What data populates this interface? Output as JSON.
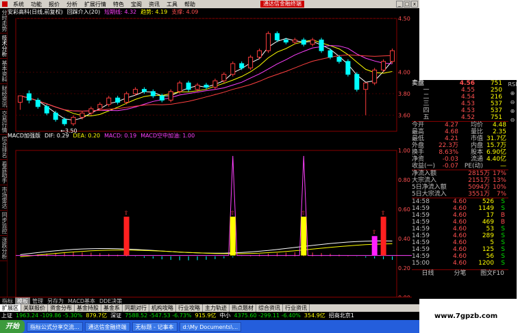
{
  "menubar": {
    "items": [
      "系统",
      "功能",
      "报价",
      "分析",
      "扩展行情",
      "特色",
      "宝阁",
      "资讯",
      "工具",
      "帮助"
    ],
    "brand": "通达信金融终端"
  },
  "main_header": {
    "title": "安彩高科(日线,前复权)",
    "period": "回踩介入(20)",
    "ind1": "短期线: 4.32",
    "ind2": "趋势: 4.19",
    "ind3": "支撑: 4.09"
  },
  "left_tabs": [
    "分时走势",
    "技术分析",
    "基本资料",
    "财经资讯",
    "交易行情",
    "综合排名",
    "看盘助手",
    "市场雷达",
    "同步监控",
    "涨跌分析"
  ],
  "price_axis": [
    "4.50",
    "4.00",
    "3.80",
    "3.60"
  ],
  "ind_axis": [
    "1.00",
    "0.80",
    "0.60",
    "0.40",
    "0.20",
    "0.00"
  ],
  "low_label": "←3.50",
  "indicator_header": {
    "name": "MACD加强版",
    "dif": "DIF: 0.29",
    "dea": "DEA: 0.20",
    "macd": "MACD: 0.19",
    "macd2": "MACD空中加油: 1.00"
  },
  "date_axis": [
    "2013年",
    "5",
    "6"
  ],
  "bottom_tabs": [
    "指标",
    "模板",
    "管理",
    "另存为",
    "MACD基本",
    "DDE决策"
  ],
  "bottom_tabs2": [
    "扩展区",
    "关联报价",
    "资金分布",
    "基金持股",
    "基金系",
    "同期对行",
    "机构攻略",
    "行业攻略",
    "主力轨迹",
    "热点题材",
    "综合资讯",
    "行业资讯"
  ],
  "right_tabs": [
    "日线",
    "分笔",
    "图文F10"
  ],
  "ticker": {
    "sh": "上证",
    "sh_val": "1963.24 -109.86 -5.30%",
    "sh_amt": "879.7亿",
    "sz": "深证",
    "sz_val": "7588.52 -547.53 -6.73%",
    "sz_amt": "915.9亿",
    "zx": "中小",
    "zx_val": "4375.60 -299.11 -6.40%",
    "zx_amt": "354.9亿",
    "loc": "招商北京1"
  },
  "quote": {
    "sell_header": "卖盘",
    "sell_price": "4.56",
    "sell_vol": "751",
    "asks": [
      [
        "一",
        "4.55",
        "250"
      ],
      [
        "二",
        "4.54",
        "216"
      ],
      [
        "三",
        "4.53",
        "537"
      ],
      [
        "四",
        "4.53",
        "537"
      ],
      [
        "五",
        "4.52",
        "751"
      ]
    ],
    "stats": [
      [
        "今开",
        "4.27",
        "均价",
        "4.48"
      ],
      [
        "最高",
        "4.68",
        "量比",
        "2.35"
      ],
      [
        "最低",
        "4.21",
        "市值",
        "31.7亿"
      ],
      [
        "外盘",
        "22.3万",
        "内盘",
        "15.7万"
      ],
      [
        "换手",
        "8.63%",
        "股本",
        "6.90亿"
      ],
      [
        "净资",
        "-0.03",
        "流通",
        "4.40亿"
      ],
      [
        "收益(一)",
        "-0.07",
        "PE(动)",
        "—"
      ]
    ],
    "flows": [
      [
        "净流入额",
        "2815万",
        "17%"
      ],
      [
        "大宗流入",
        "2151万",
        "13%"
      ],
      [
        "5日净流入额",
        "5094万",
        "10%"
      ],
      [
        "5日大宗流入",
        "3551万",
        "7%"
      ]
    ],
    "ticks": [
      [
        "14:58",
        "4.60",
        "526",
        "S"
      ],
      [
        "14:59",
        "4.60",
        "1149",
        "S"
      ],
      [
        "14:59",
        "4.60",
        "17",
        "B"
      ],
      [
        "14:59",
        "4.60",
        "469",
        "B"
      ],
      [
        "14:59",
        "4.60",
        "53",
        "S"
      ],
      [
        "14:59",
        "4.60",
        "289",
        "S"
      ],
      [
        "14:59",
        "4.60",
        "5",
        "S"
      ],
      [
        "14:59",
        "4.60",
        "125",
        "S"
      ],
      [
        "14:59",
        "4.60",
        "56",
        "S"
      ],
      [
        "15:00",
        "4.60",
        "1200",
        "S"
      ]
    ]
  },
  "right_side_tabs": [
    "RSI",
    "⊕",
    "⊖",
    "⊕",
    "⊖"
  ],
  "taskbar": {
    "start": "开始",
    "tasks": [
      "指标公式分享交流...",
      "通达信金融终端",
      "无标题 - 记事本",
      "d:\\My Documents\\..."
    ]
  },
  "watermark": "www.7gpzb.com",
  "colors": {
    "up": "#ff3c3c",
    "down": "#00ffff",
    "ma1": "#ffffff",
    "ma2": "#ffff00",
    "ma3": "#ff40ff",
    "ma4": "#ff4040"
  },
  "chart_data": {
    "type": "candlestick",
    "candles": [
      [
        3.72,
        3.78,
        3.66,
        3.65
      ],
      [
        3.8,
        3.74,
        3.83,
        3.71
      ],
      [
        3.74,
        3.68,
        3.76,
        3.66
      ],
      [
        3.68,
        3.62,
        3.7,
        3.6
      ],
      [
        3.62,
        3.56,
        3.64,
        3.54
      ],
      [
        3.56,
        3.52,
        3.58,
        3.5
      ],
      [
        3.52,
        3.58,
        3.5,
        3.6
      ],
      [
        3.58,
        3.62,
        3.56,
        3.64
      ],
      [
        3.62,
        3.66,
        3.6,
        3.68
      ],
      [
        3.66,
        3.7,
        3.64,
        3.72
      ],
      [
        3.7,
        3.76,
        3.68,
        3.78
      ],
      [
        3.76,
        3.72,
        3.78,
        3.7
      ],
      [
        3.72,
        3.8,
        3.7,
        3.82
      ],
      [
        3.8,
        3.84,
        3.78,
        3.86
      ],
      [
        3.84,
        3.82,
        3.86,
        3.8
      ],
      [
        3.82,
        3.78,
        3.84,
        3.76
      ],
      [
        3.78,
        3.74,
        3.8,
        3.72
      ],
      [
        3.74,
        3.82,
        3.72,
        3.84
      ],
      [
        3.82,
        3.9,
        3.8,
        3.92
      ],
      [
        3.9,
        3.84,
        3.92,
        3.82
      ],
      [
        3.84,
        3.88,
        3.82,
        3.9
      ],
      [
        3.88,
        3.86,
        3.9,
        3.84
      ],
      [
        3.86,
        3.92,
        3.84,
        3.94
      ],
      [
        3.92,
        3.98,
        3.9,
        4.0
      ],
      [
        3.98,
        4.08,
        3.96,
        4.1
      ],
      [
        4.08,
        4.04,
        4.1,
        4.02
      ],
      [
        4.04,
        4.14,
        4.02,
        4.16
      ],
      [
        4.14,
        4.2,
        4.12,
        4.22
      ],
      [
        4.2,
        4.36,
        4.18,
        4.38
      ],
      [
        4.36,
        4.3,
        4.38,
        4.28
      ],
      [
        4.3,
        4.28,
        4.32,
        4.26
      ],
      [
        4.28,
        4.3,
        4.26,
        4.32
      ],
      [
        4.3,
        4.26,
        4.32,
        4.24
      ],
      [
        4.26,
        4.3,
        4.24,
        4.32
      ],
      [
        4.3,
        4.2,
        4.32,
        4.18
      ],
      [
        4.2,
        4.14,
        4.22,
        4.12
      ],
      [
        4.14,
        4.1,
        4.16,
        4.08
      ],
      [
        4.1,
        3.98,
        4.12,
        3.96
      ],
      [
        3.98,
        3.84,
        4.0,
        3.82
      ],
      [
        3.84,
        3.9,
        3.82,
        3.6
      ],
      [
        3.9,
        4.02,
        3.88,
        4.04
      ],
      [
        4.02,
        4.1,
        4.0,
        4.12
      ],
      [
        4.1,
        4.2,
        4.08,
        4.22
      ]
    ],
    "ylim": [
      3.45,
      4.5
    ],
    "macd_signal": {
      "bars": [
        {
          "i": 12,
          "color": "red",
          "v": 0.22
        },
        {
          "i": 24,
          "color": "yellow",
          "v": 0.22
        },
        {
          "i": 32,
          "color": "yellow",
          "v": 0.22
        },
        {
          "i": 40,
          "color": "magenta",
          "v": 0.11
        },
        {
          "i": 41,
          "color": "red",
          "v": 0.22
        },
        {
          "i": 46,
          "color": "yellow",
          "v": 0.09
        }
      ],
      "spikes": [
        24,
        32,
        46
      ]
    }
  }
}
